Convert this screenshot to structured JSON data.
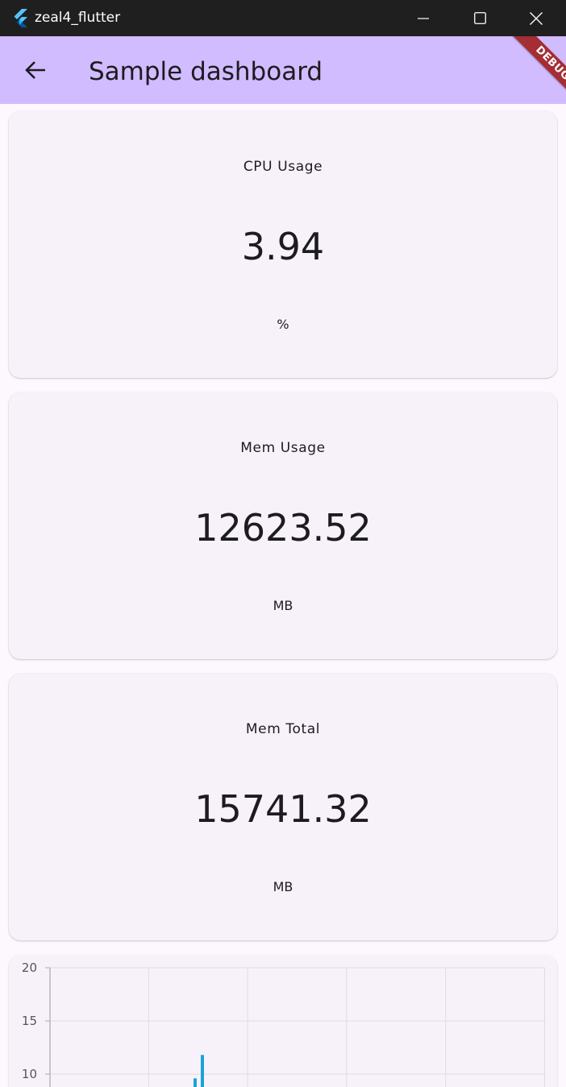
{
  "window": {
    "title": "zeal4_flutter",
    "logo_icon": "flutter-logo-icon",
    "controls": {
      "minimize_icon": "minimize-icon",
      "maximize_icon": "maximize-icon",
      "close_icon": "close-icon"
    }
  },
  "appbar": {
    "title": "Sample dashboard",
    "back_icon": "arrow-left-icon",
    "debug_banner": "DEBUG",
    "background": "#d1bcff"
  },
  "cards": [
    {
      "label": "CPU Usage",
      "value": "3.94",
      "unit": "%"
    },
    {
      "label": "Mem Usage",
      "value": "12623.52",
      "unit": "MB"
    },
    {
      "label": "Mem Total",
      "value": "15741.32",
      "unit": "MB"
    }
  ],
  "chart_data": {
    "type": "bar",
    "ylim": [
      0,
      20
    ],
    "y_ticks": [
      "20",
      "15",
      "10"
    ],
    "grid": true,
    "bar_color": "#1aa3d9",
    "series": [
      {
        "values": [
          9.6,
          11.8
        ]
      }
    ]
  }
}
